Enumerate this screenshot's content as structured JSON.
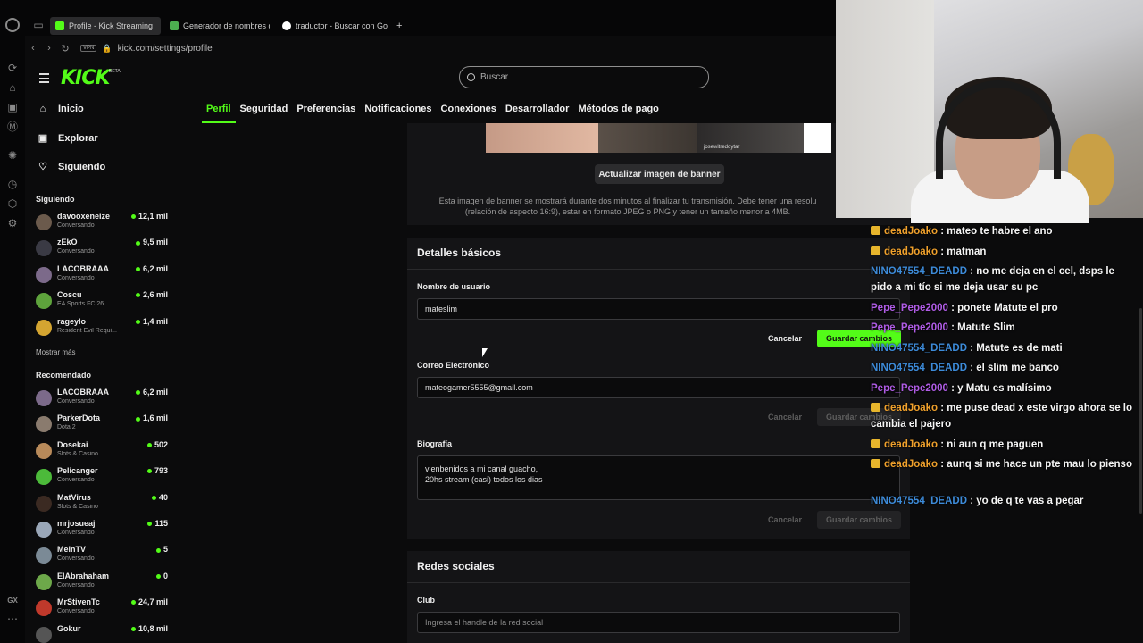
{
  "browser": {
    "tabs": [
      {
        "label": "Profile - Kick Streaming",
        "color": "#53fc18"
      },
      {
        "label": "Generador de nombres de",
        "color": "#4caf50"
      },
      {
        "label": "traductor - Buscar con Go",
        "color": "#4285f4"
      }
    ],
    "new_tab": "+",
    "vpn": "VPN",
    "url": "kick.com/settings/profile",
    "rail_label": "GX"
  },
  "app": {
    "logo": "KICK",
    "beta": "BETA",
    "search_placeholder": "Buscar",
    "nav": [
      {
        "label": "Inicio",
        "icon": "home-icon"
      },
      {
        "label": "Explorar",
        "icon": "compass-icon"
      },
      {
        "label": "Siguiendo",
        "icon": "heart-icon"
      }
    ],
    "following_title": "Siguiendo",
    "following": [
      {
        "name": "davooxeneize",
        "category": "Conversando",
        "viewers": "12,1 mil",
        "color": "#6b5a4c"
      },
      {
        "name": "zEkO",
        "category": "Conversando",
        "viewers": "9,5 mil",
        "color": "#3a3a44"
      },
      {
        "name": "LACOBRAAA",
        "category": "Conversando",
        "viewers": "6,2 mil",
        "color": "#7c6a8a"
      },
      {
        "name": "Coscu",
        "category": "EA Sports FC 26",
        "viewers": "2,6 mil",
        "color": "#5ea33c"
      },
      {
        "name": "rageylo",
        "category": "Resident Evil Requi...",
        "viewers": "1,4 mil",
        "color": "#d4a531"
      }
    ],
    "show_more": "Mostrar más",
    "recommended_title": "Recomendado",
    "recommended": [
      {
        "name": "LACOBRAAA",
        "category": "Conversando",
        "viewers": "6,2 mil",
        "color": "#7c6a8a"
      },
      {
        "name": "ParkerDota",
        "category": "Dota 2",
        "viewers": "1,6 mil",
        "color": "#8a7b6e"
      },
      {
        "name": "Dosekai",
        "category": "Slots & Casino",
        "viewers": "502",
        "color": "#b88a5a"
      },
      {
        "name": "Pelicanger",
        "category": "Conversando",
        "viewers": "793",
        "color": "#4cba3a"
      },
      {
        "name": "MatVirus",
        "category": "Slots & Casino",
        "viewers": "40",
        "color": "#3b2a22"
      },
      {
        "name": "mrjosueaj",
        "category": "Conversando",
        "viewers": "115",
        "color": "#9aa7b8"
      },
      {
        "name": "MeinTV",
        "category": "Conversando",
        "viewers": "5",
        "color": "#7b8a96"
      },
      {
        "name": "ElAbrahaham",
        "category": "Conversando",
        "viewers": "0",
        "color": "#6da84a"
      },
      {
        "name": "MrStivenTc",
        "category": "Conversando",
        "viewers": "24,7 mil",
        "color": "#c0392b"
      },
      {
        "name": "Gokur",
        "category": "",
        "viewers": "10,8 mil",
        "color": "#555"
      }
    ],
    "settings_tabs": [
      "Perfil",
      "Seguridad",
      "Preferencias",
      "Notificaciones",
      "Conexiones",
      "Desarrollador",
      "Métodos de pago"
    ],
    "banner_watermark": "josewitredoytar",
    "banner_button": "Actualizar imagen de banner",
    "banner_note_1": "Esta imagen de banner se mostrará durante dos minutos al finalizar tu transmisión. Debe tener una resolu",
    "banner_note_2": "(relación de aspecto 16:9), estar en formato JPEG o PNG y tener un tamaño menor a 4MB.",
    "basic_title": "Detalles básicos",
    "username_label": "Nombre de usuario",
    "username_value": "mateslim",
    "email_label": "Correo Electrónico",
    "email_value": "mateogamer5555@gmail.com",
    "bio_label": "Biografía",
    "bio_line1": "vienbenidos a mi canal guacho,",
    "bio_line2": "20hs stream (casi) todos los dias",
    "cancel": "Cancelar",
    "save": "Guardar cambios",
    "social_title": "Redes sociales",
    "club_label": "Club",
    "club_placeholder": "Ingresa el handle de la red social"
  },
  "chat": [
    {
      "user": "deadJoako",
      "text": ": mateo te habre el ano",
      "color": "#f0a12c",
      "badge": true
    },
    {
      "user": "deadJoako",
      "text": ": matman",
      "color": "#f0a12c",
      "badge": true
    },
    {
      "user": "NINO47554_DEADD",
      "text": ": no me deja en el cel, dsps le pido a mi tío si me deja usar su pc",
      "color": "#3d8bd9",
      "badge": false
    },
    {
      "user": "Pepe_Pepe2000",
      "text": ": ponete Matute el pro",
      "color": "#b05ce6",
      "badge": false
    },
    {
      "user": "Pepe_Pepe2000",
      "text": ": Matute Slim",
      "color": "#b05ce6",
      "badge": false
    },
    {
      "user": "NINO47554_DEADD",
      "text": ": Matute es de mati",
      "color": "#3d8bd9",
      "badge": false
    },
    {
      "user": "NINO47554_DEADD",
      "text": ": el slim me banco",
      "color": "#3d8bd9",
      "badge": false
    },
    {
      "user": "Pepe_Pepe2000",
      "text": ": y Matu es malísimo",
      "color": "#b05ce6",
      "badge": false
    },
    {
      "user": "deadJoako",
      "text": ": me puse dead x este virgo ahora se lo cambia el pajero",
      "color": "#f0a12c",
      "badge": true
    },
    {
      "user": "deadJoako",
      "text": ": ni aun q me paguen",
      "color": "#f0a12c",
      "badge": true
    },
    {
      "user": "deadJoako",
      "text": ": aunq si me hace un pte mau lo pienso",
      "color": "#f0a12c",
      "badge": true
    },
    {
      "user": "NINO47554_DEADD",
      "text": ": yo de q te vas a pegar",
      "color": "#3d8bd9",
      "badge": false
    }
  ]
}
